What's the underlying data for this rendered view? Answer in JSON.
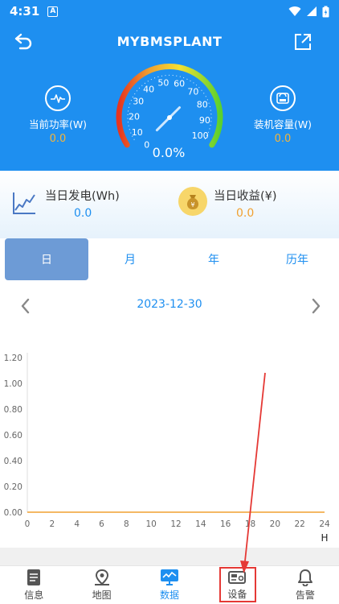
{
  "status_bar": {
    "time": "4:31",
    "notification_glyph": "A",
    "icons": [
      "wifi-icon",
      "signal-icon",
      "battery-icon"
    ]
  },
  "header": {
    "title": "MYBMSPLANT",
    "icons": [
      "back-icon",
      "share-icon"
    ],
    "current_power": {
      "label": "当前功率(W)",
      "value": "0.0",
      "icon": "waveform-icon"
    },
    "installed_capacity": {
      "label": "装机容量(W)",
      "value": "0.0",
      "icon": "capacity-icon"
    },
    "gauge": {
      "ticks": [
        "0",
        "10",
        "20",
        "30",
        "40",
        "50",
        "60",
        "70",
        "80",
        "90",
        "100"
      ],
      "percent_text": "0.0%",
      "level": 0.0
    }
  },
  "energy": {
    "daily_generation": {
      "label": "当日发电(Wh)",
      "value": "0.0",
      "icon": "line-chart-icon"
    },
    "daily_income": {
      "label": "当日收益(¥)",
      "value": "0.0",
      "icon": "money-bag-icon"
    }
  },
  "period_tabs": [
    {
      "label": "日",
      "active": true
    },
    {
      "label": "月",
      "active": false
    },
    {
      "label": "年",
      "active": false
    },
    {
      "label": "历年",
      "active": false
    }
  ],
  "date_nav": {
    "date": "2023-12-30",
    "icons": [
      "chevron-left-icon",
      "chevron-right-icon"
    ]
  },
  "chart_data": {
    "type": "line",
    "x": [
      0,
      1,
      2,
      3,
      4,
      5,
      6,
      7,
      8,
      9,
      10,
      11,
      12,
      13,
      14,
      15,
      16,
      17,
      18,
      19,
      20,
      21,
      22,
      23,
      24
    ],
    "series": [
      {
        "values": [
          0,
          0,
          0,
          0,
          0,
          0,
          0,
          0,
          0,
          0,
          0,
          0,
          0,
          0,
          0,
          0,
          0,
          0,
          0,
          0,
          0,
          0,
          0,
          0,
          0
        ]
      }
    ],
    "x_ticks": [
      "0",
      "2",
      "4",
      "6",
      "8",
      "10",
      "12",
      "14",
      "16",
      "18",
      "20",
      "22",
      "24"
    ],
    "y_ticks": [
      "0.00",
      "0.20",
      "0.40",
      "0.60",
      "0.80",
      "1.00",
      "1.20"
    ],
    "x_unit": "H",
    "xlim": [
      0,
      24
    ],
    "ylim": [
      0,
      1.2
    ],
    "line_color": "#f0a030",
    "grid": false
  },
  "bottom_nav": [
    {
      "label": "信息",
      "icon": "document-icon",
      "active": false
    },
    {
      "label": "地图",
      "icon": "map-pin-icon",
      "active": false
    },
    {
      "label": "数据",
      "icon": "monitor-chart-icon",
      "active": true
    },
    {
      "label": "设备",
      "icon": "device-icon",
      "active": false
    },
    {
      "label": "告警",
      "icon": "bell-icon",
      "active": false
    }
  ],
  "colors": {
    "primary": "#1e8ff0",
    "value_orange": "#f5b53a",
    "active_tab": "#6d9bd6",
    "annotation_red": "#e53935"
  }
}
